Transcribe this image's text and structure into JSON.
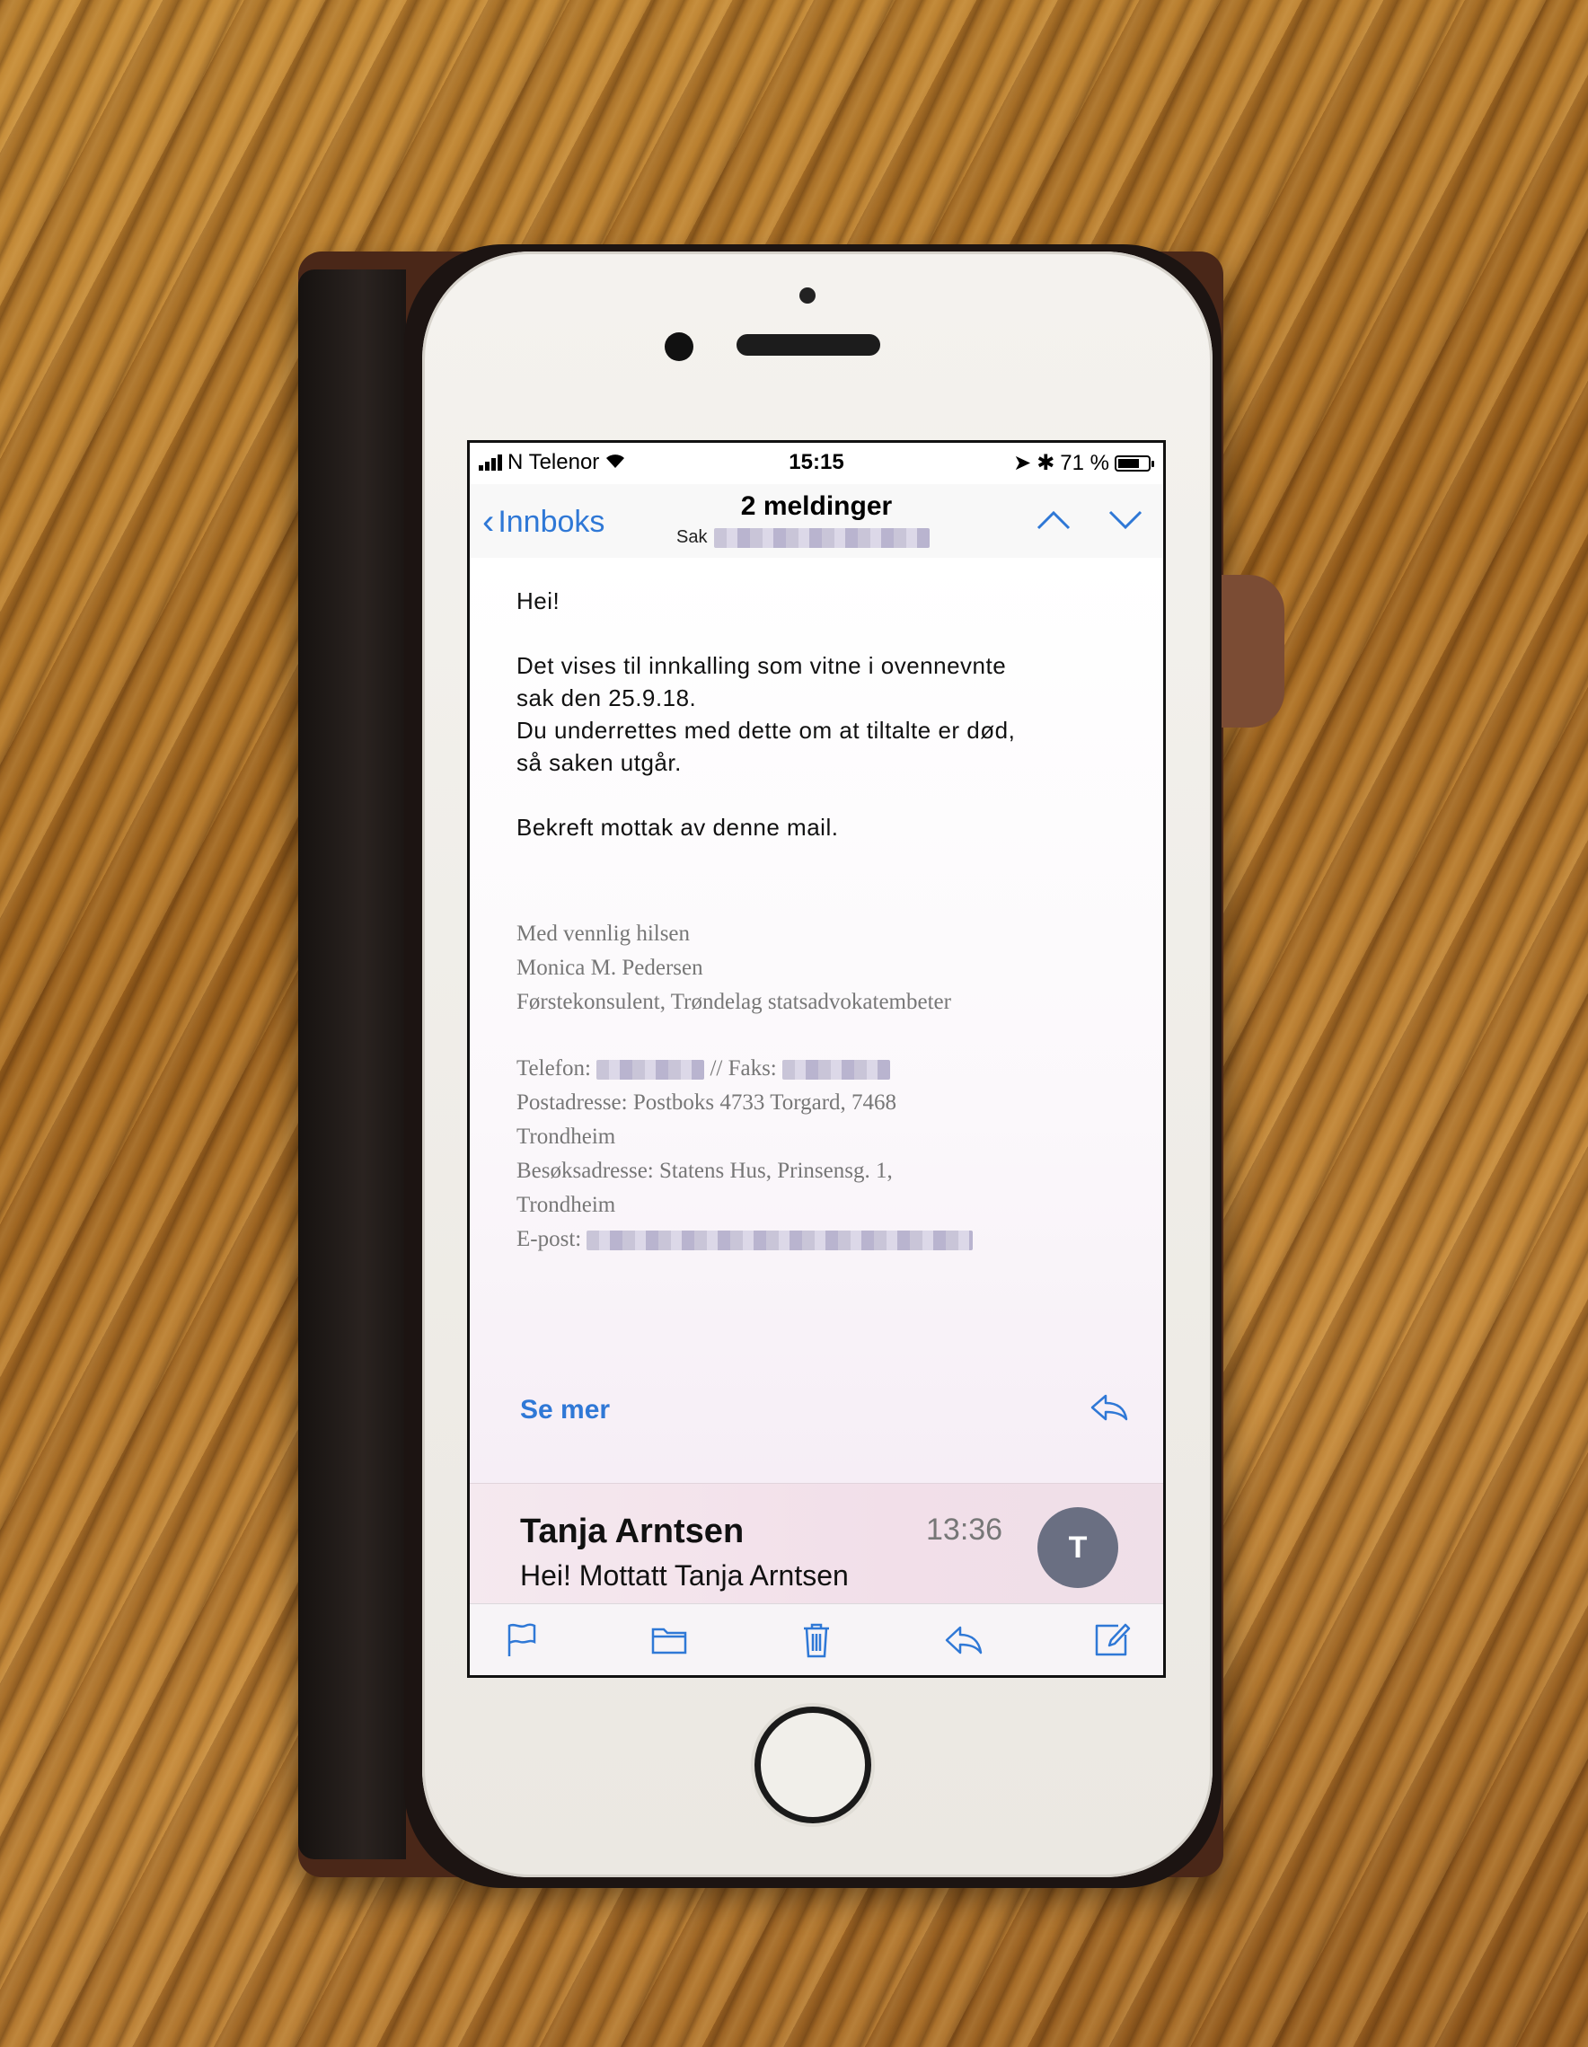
{
  "status_bar": {
    "carrier": "N Telenor",
    "time": "15:15",
    "battery_percent": "71 %",
    "battery_level": 0.71
  },
  "nav": {
    "back_label": "Innboks",
    "title": "2 meldinger",
    "subtitle_prefix": "Sak"
  },
  "message": {
    "greeting": "Hei!",
    "line1": "Det vises til innkalling som vitne i ovennevnte",
    "line2": "sak den 25.9.18.",
    "line3": "Du underrettes med dette om at tiltalte er død,",
    "line4": "så saken utgår.",
    "line5": "Bekreft mottak av denne mail.",
    "signature": {
      "closing": "Med vennlig hilsen",
      "name": "Monica M. Pedersen",
      "title": "Førstekonsulent, Trøndelag statsadvokatembeter",
      "phone_label": "Telefon:",
      "fax_label": "// Faks:",
      "postal": "Postadresse: Postboks 4733 Torgard, 7468",
      "postal_city": "Trondheim",
      "visit": "Besøksadresse: Statens Hus, Prinsensg. 1,",
      "visit_city": "Trondheim",
      "email_label": "E-post:"
    },
    "see_more": "Se mer"
  },
  "second_message": {
    "sender": "Tanja Arntsen",
    "time": "13:36",
    "preview": "Hei! Mottatt Tanja Arntsen",
    "avatar_initial": "T"
  },
  "toolbar": {
    "icons": [
      "flag-icon",
      "folder-icon",
      "trash-icon",
      "reply-icon",
      "compose-icon"
    ]
  },
  "colors": {
    "accent": "#2f78d6",
    "avatar": "#6a6f82"
  }
}
